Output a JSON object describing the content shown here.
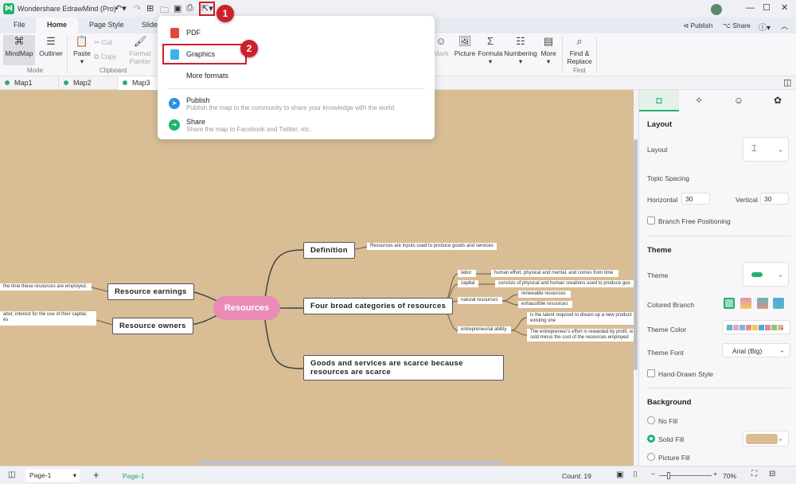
{
  "app": {
    "title": "Wondershare EdrawMind (Pro)",
    "publish": "Publish",
    "share": "Share"
  },
  "menu_tabs": [
    "File",
    "Home",
    "Page Style",
    "Slides"
  ],
  "ribbon": {
    "mode": {
      "mindmap": "MindMap",
      "outliner": "Outliner",
      "group": "Mode"
    },
    "clipboard": {
      "paste": "Paste",
      "cut": "Cut",
      "copy": "Copy",
      "format_painter": "Format Painter",
      "group": "Clipboard"
    },
    "insert": {
      "mark": "Mark",
      "picture": "Picture",
      "formula": "Formula",
      "numbering": "Numbering",
      "more": "More"
    },
    "find": {
      "find_replace": "Find & Replace",
      "group": "Find"
    }
  },
  "doc_tabs": [
    "Map1",
    "Map2",
    "Map3"
  ],
  "export_menu": {
    "pdf": "PDF",
    "graphics": "Graphics",
    "more_formats": "More formats",
    "publish": "Publish",
    "publish_desc": "Publish the map to the community to share your knowledge with the world.",
    "share": "Share",
    "share_desc": "Share the map to Facebook and Twitter, etc."
  },
  "annotations": {
    "step1": "1",
    "step2": "2",
    "highlight_color": "#d0202a"
  },
  "mindmap": {
    "central": "Resources",
    "central_color": "#e98bb5",
    "background_color": "#d8bd95",
    "definition": "Definition",
    "definition_note": "Resources are inputs used to produce goods and services",
    "four_categories": "Four broad categories of resources",
    "categories": {
      "labor": "labor",
      "labor_note": "human effort, physical and mental, and comes from time",
      "capital": "capital",
      "capital_note": "consists of physical and human creations used to produce goo",
      "natural": "natural resources",
      "renewable": "renewable  resources",
      "exhaustible": "exhaustible resources",
      "entrepreneurial": "entrepreneurial ability",
      "entre_note1": "is the talent required to dream up a new product",
      "entre_note1b": "existing one",
      "entre_note2": "The entrepreneur's effort is rewarded by profit, w",
      "entre_note2b": "sold minus the cost of the resources employed"
    },
    "goods": "Goods and services are scarce because resources are scarce",
    "earnings": "Resource earnings",
    "earnings_note": "the time these resources are employed.",
    "owners": "Resource owners",
    "owners_note1": "abor, interest for the use of their capital,",
    "owners_note2": "es"
  },
  "panel": {
    "layout_heading": "Layout",
    "layout_label": "Layout",
    "topic_spacing": "Topic Spacing",
    "horizontal_label": "Horizontal",
    "horizontal_value": "30",
    "vertical_label": "Vertical",
    "vertical_value": "30",
    "branch_free": "Branch Free Positioning",
    "theme_heading": "Theme",
    "theme_label": "Theme",
    "colored_branch": "Colored Branch",
    "theme_color": "Theme Color",
    "theme_font": "Theme Font",
    "theme_font_value": "Arial (Big)",
    "hand_drawn": "Hand-Drawn Style",
    "background_heading": "Background",
    "no_fill": "No Fill",
    "solid_fill": "Solid Fill",
    "picture_fill": "Picture Fill",
    "fill_selected": "Solid Fill",
    "fill_color": "#d8bd95",
    "theme_palette": [
      "#5bb8c4",
      "#e3a3c8",
      "#7fb2e0",
      "#e58f7a",
      "#f1c95a",
      "#52a8d4",
      "#e8849e",
      "#94c46f",
      "#d8bd95"
    ]
  },
  "status": {
    "page_select": "Page-1",
    "page_tab": "Page-1",
    "count": "Count: 19",
    "zoom": "70%"
  }
}
